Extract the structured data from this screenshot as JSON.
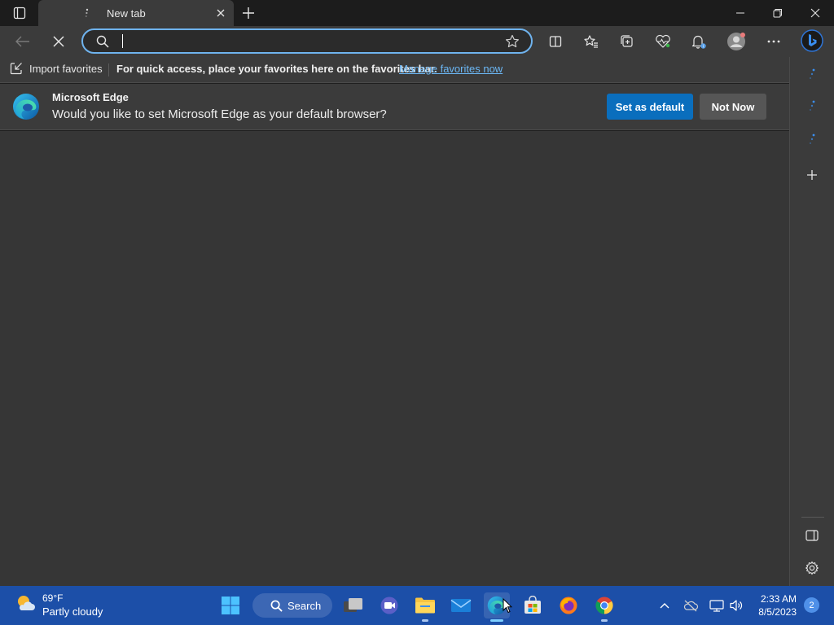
{
  "tab": {
    "title": "New tab"
  },
  "addressbar": {
    "value": "",
    "placeholder": ""
  },
  "favorites_bar": {
    "import_label": "Import favorites",
    "hint": "For quick access, place your favorites here on the favorites bar.",
    "manage_link": "Manage favorites now"
  },
  "infobar": {
    "title": "Microsoft Edge",
    "message": "Would you like to set Microsoft Edge as your default browser?",
    "primary_button": "Set as default",
    "secondary_button": "Not Now"
  },
  "taskbar": {
    "weather_temp": "69°F",
    "weather_condition": "Partly cloudy",
    "search_label": "Search",
    "time": "2:33 AM",
    "date": "8/5/2023",
    "notification_count": "2"
  },
  "colors": {
    "accent": "#0a6ebd",
    "link": "#6cb8f6",
    "taskbar": "#1c4fa8",
    "address_focus": "#6fb3ee"
  }
}
